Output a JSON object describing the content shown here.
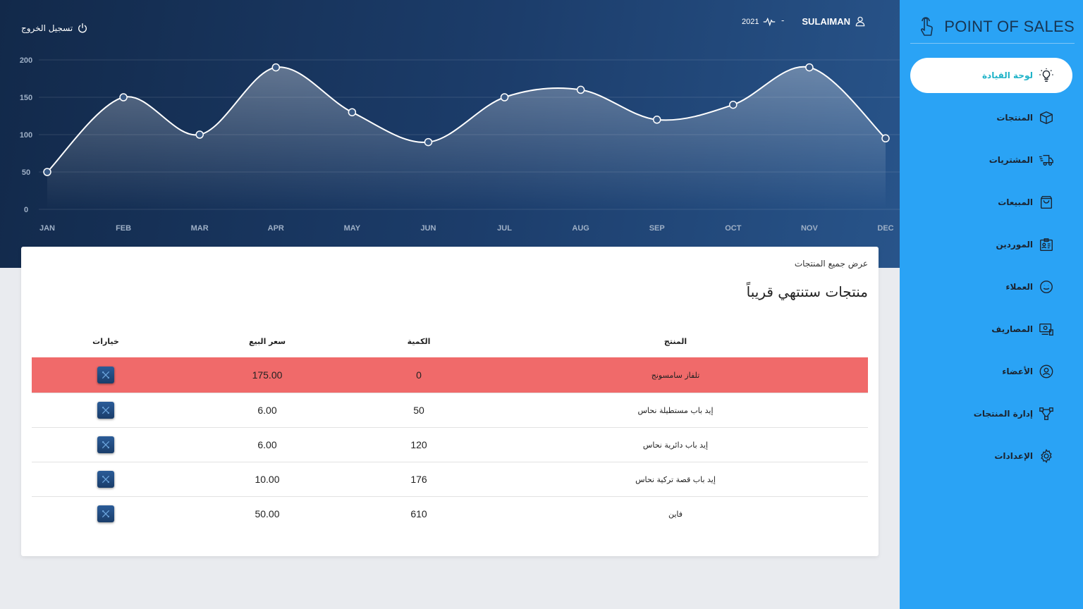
{
  "header": {
    "logout_label": "تسجيل الخروج",
    "username": "SULAIMAN",
    "separator": "-",
    "year": "2021"
  },
  "chart_data": {
    "type": "area",
    "categories": [
      "JAN",
      "FEB",
      "MAR",
      "APR",
      "MAY",
      "JUN",
      "JUL",
      "AUG",
      "SEP",
      "OCT",
      "NOV",
      "DEC"
    ],
    "values": [
      50,
      150,
      100,
      190,
      130,
      90,
      150,
      160,
      120,
      140,
      190,
      95
    ],
    "yticks": [
      0,
      50,
      100,
      150,
      200
    ],
    "ylim": [
      0,
      200
    ],
    "grid": true,
    "legend": false
  },
  "card": {
    "view_all_link": "عرض جميع المنتجات",
    "title": "منتجات ستنتهي قريباً",
    "columns": {
      "product": "المنتج",
      "quantity": "الكمية",
      "price": "سعر البيع",
      "options": "خيارات"
    },
    "rows": [
      {
        "product": "تلفاز سامسونج",
        "quantity": "0",
        "price": "175.00",
        "alert": true
      },
      {
        "product": "إيد باب مستطيلة نحاس",
        "quantity": "50",
        "price": "6.00",
        "alert": false
      },
      {
        "product": "إيد باب دائرية نحاس",
        "quantity": "120",
        "price": "6.00",
        "alert": false
      },
      {
        "product": "إيد باب قصة تركية نحاس",
        "quantity": "176",
        "price": "10.00",
        "alert": false
      },
      {
        "product": "فاين",
        "quantity": "610",
        "price": "50.00",
        "alert": false
      }
    ]
  },
  "sidebar": {
    "brand": "POINT OF SALES",
    "items": [
      {
        "label": "لوحة القيادة",
        "icon": "lightbulb-icon",
        "active": true
      },
      {
        "label": "المنتجات",
        "icon": "box-icon",
        "active": false
      },
      {
        "label": "المشتريات",
        "icon": "delivery-truck-icon",
        "active": false
      },
      {
        "label": "المبيعات",
        "icon": "shopping-bag-icon",
        "active": false
      },
      {
        "label": "الموردين",
        "icon": "id-card-icon",
        "active": false
      },
      {
        "label": "العملاء",
        "icon": "smiley-icon",
        "active": false
      },
      {
        "label": "المصاريف",
        "icon": "money-icon",
        "active": false
      },
      {
        "label": "الأعضاء",
        "icon": "user-circle-icon",
        "active": false
      },
      {
        "label": "إدارة المنتجات",
        "icon": "nodes-icon",
        "active": false
      },
      {
        "label": "الإعدادات",
        "icon": "gear-icon",
        "active": false
      }
    ]
  },
  "colors": {
    "sidebar_bg": "#2aa3f5",
    "hero_bg": "#1c3d6b",
    "alert_row": "#f06a6a",
    "active_text": "#1fb3c8"
  }
}
